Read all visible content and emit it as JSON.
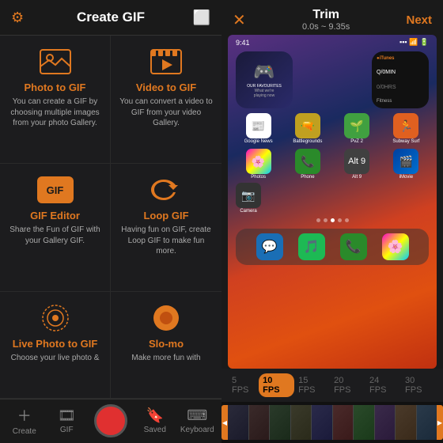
{
  "left": {
    "header": {
      "title": "Create GIF",
      "gear_icon": "⚙",
      "upload_icon": "📋"
    },
    "grid": [
      {
        "id": "photo-to-gif",
        "icon": "🖼",
        "title": "Photo to GIF",
        "desc": "You can create a GIF by choosing multiple images from your photo Gallery."
      },
      {
        "id": "video-to-gif",
        "icon": "🎬",
        "title": "Video to GIF",
        "desc": "You can convert a video to GIF from your video Gallery."
      },
      {
        "id": "gif-editor",
        "icon": "GIF",
        "title": "GIF Editor",
        "desc": "Share the Fun of GIF with your Gallery GIF."
      },
      {
        "id": "loop-gif",
        "icon": "∞",
        "title": "Loop GIF",
        "desc": "Having fun on GIF, create Loop GIF to make fun more."
      },
      {
        "id": "live-photo-to-gif",
        "icon": "◎",
        "title": "Live Photo to GIF",
        "desc": "Choose your live photo &"
      },
      {
        "id": "slo-mo",
        "icon": "●",
        "title": "Slo-mo",
        "desc": "Make more fun with"
      }
    ],
    "nav": {
      "items": [
        {
          "id": "create",
          "icon": "＋",
          "label": "Create"
        },
        {
          "id": "gif",
          "icon": "🎞",
          "label": "GIF"
        },
        {
          "id": "record",
          "icon": "",
          "label": ""
        },
        {
          "id": "saved",
          "icon": "🔖",
          "label": "Saved"
        },
        {
          "id": "keyboard",
          "icon": "⌨",
          "label": "Keyboard"
        }
      ]
    }
  },
  "right": {
    "header": {
      "close_icon": "✕",
      "title": "Trim",
      "subtitle": "0.0s ~ 9.35s",
      "next_label": "Next"
    },
    "fps_options": [
      "5 FPS",
      "10 FPS",
      "15 FPS",
      "20 FPS",
      "24 FPS",
      "30 FPS"
    ],
    "fps_active": "10 FPS",
    "timeline": {
      "thumb_count": 10
    }
  }
}
